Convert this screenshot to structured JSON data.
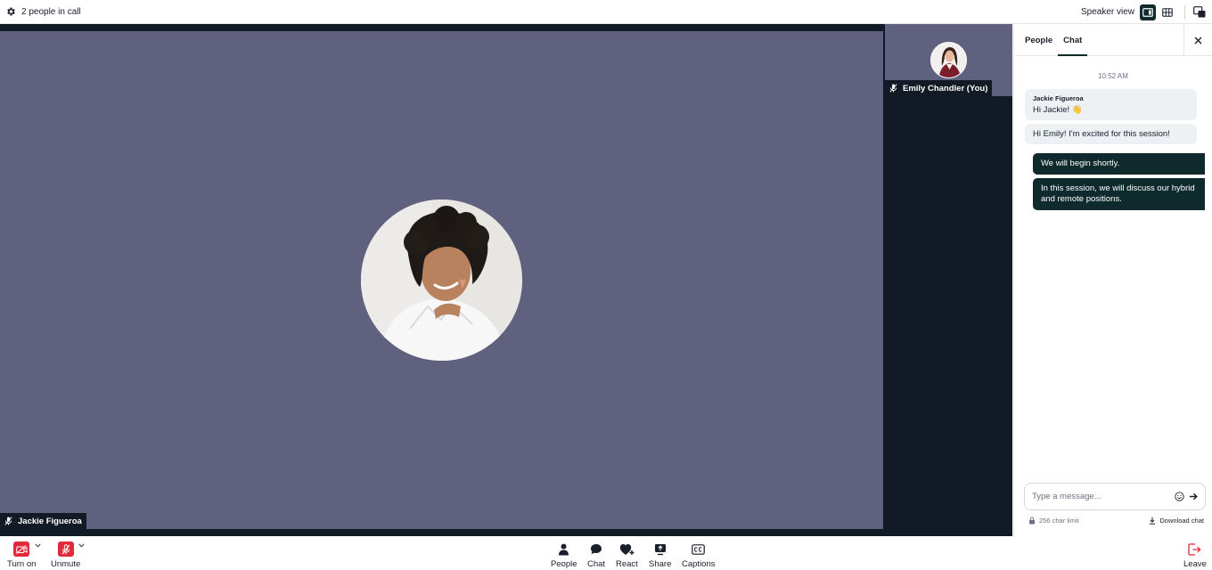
{
  "topbar": {
    "people_in_call": "2 people in call",
    "view_label": "Speaker view",
    "icons": [
      "gear-icon",
      "speaker-view-icon",
      "grid-view-icon",
      "popout-icon"
    ]
  },
  "stage": {
    "main_participant": {
      "name": "Jackie Figueroa",
      "muted": true
    },
    "self_participant": {
      "name": "Emily Chandler (You)",
      "muted": true
    },
    "tile_color": "#5f617f",
    "background_color": "#121a25"
  },
  "panel": {
    "tabs": [
      {
        "label": "People",
        "active": false
      },
      {
        "label": "Chat",
        "active": true
      }
    ],
    "timestamp": "10:52 AM",
    "messages_in": [
      {
        "sender": "Jackie Figueroa",
        "text": "Hi Jackie! 👋"
      },
      {
        "text": "Hi Emily! I'm excited for this session!"
      }
    ],
    "messages_out": [
      {
        "text": "We will begin shortly."
      },
      {
        "text": "In this session, we will discuss our hybrid and remote positions."
      }
    ],
    "composer": {
      "placeholder": "Type a message...",
      "value": ""
    },
    "char_limit": "256 char limit",
    "download_label": "Download chat",
    "accent_color": "#0e2a2c"
  },
  "bottombar": {
    "camera_label": "Turn on",
    "mic_label": "Unmute",
    "people_label": "People",
    "chat_label": "Chat",
    "react_label": "React",
    "share_label": "Share",
    "captions_label": "Captions",
    "leave_label": "Leave",
    "alert_color": "#e02a3a"
  }
}
